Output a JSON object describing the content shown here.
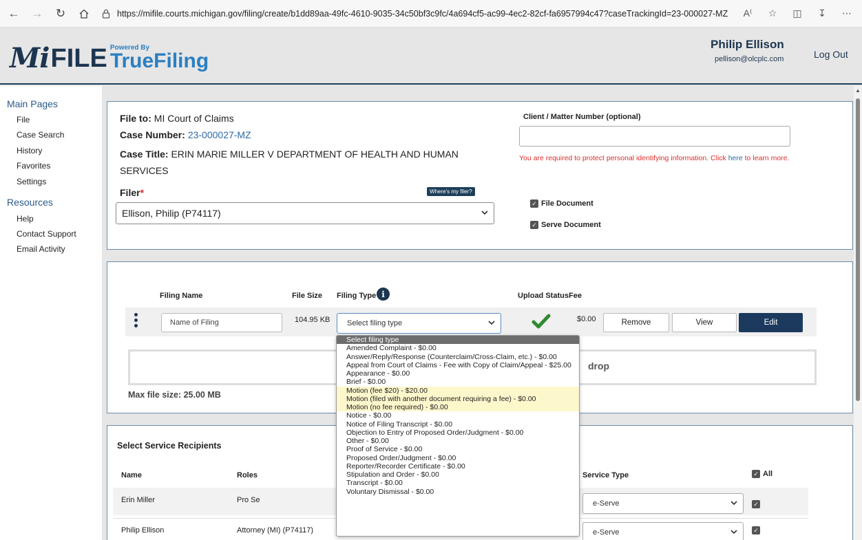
{
  "browser": {
    "url": "https://mifile.courts.michigan.gov/filing/create/b1dd89aa-49fc-4610-9035-34c50bf3c9fc/4a694cf5-ac99-4ec2-82cf-fa6957994c47?caseTrackingId=23-000027-MZ"
  },
  "header": {
    "logo_mi": "Mi",
    "logo_file": "FILE",
    "logo_powered": "Powered By",
    "logo_truefiling": "TrueFiling",
    "user_name": "Philip Ellison",
    "user_email": "pellison@olcplc.com",
    "logout": "Log Out"
  },
  "sidebar": {
    "main_heading": "Main Pages",
    "main_items": [
      "File",
      "Case Search",
      "History",
      "Favorites",
      "Settings"
    ],
    "resources_heading": "Resources",
    "resource_items": [
      "Help",
      "Contact Support",
      "Email Activity"
    ]
  },
  "case": {
    "file_to_label": "File to:",
    "file_to_value": "MI Court of Claims",
    "case_number_label": "Case Number:",
    "case_number_value": "23-000027-MZ",
    "case_title_label": "Case Title:",
    "case_title_value": "ERIN MARIE MILLER V DEPARTMENT OF HEALTH AND HUMAN SERVICES",
    "filer_label": "Filer",
    "filer_required": "*",
    "wheres_my_filer": "Where's my filer?",
    "filer_value": "Ellison, Philip (P74117)",
    "client_matter_label": "Client / Matter Number (optional)",
    "client_matter_value": "",
    "pii_text_before": "You are required to protect personal identifying information. Click ",
    "pii_link": "here",
    "pii_text_after": " to learn more.",
    "file_document_label": "File Document",
    "serve_document_label": "Serve Document"
  },
  "filing": {
    "col_filing_name": "Filing Name",
    "col_file_size": "File Size",
    "col_filing_type": "Filing Type",
    "col_upload_status": "Upload Status",
    "col_fee": "Fee",
    "name_placeholder": "Name of Filing",
    "file_size": "104.95 KB",
    "filing_type_selected": "Select filing type",
    "fee": "$0.00",
    "remove_label": "Remove",
    "view_label": "View",
    "edit_label": "Edit",
    "drop_text": "drop",
    "max_file_size": "Max file size: 25.00 MB"
  },
  "filing_type_options": [
    "Select filing type",
    "Amended Complaint - $0.00",
    "Answer/Reply/Response (Counterclaim/Cross-Claim, etc.) - $0.00",
    "Appeal from Court of Claims - Fee with Copy of Claim/Appeal - $25.00",
    "Appearance - $0.00",
    "Brief - $0.00",
    "Motion (fee $20) - $20.00",
    "Motion (filed with another document requiring a fee) - $0.00",
    "Motion (no fee required) - $0.00",
    "Notice - $0.00",
    "Notice of Filing Transcript - $0.00",
    "Objection to Entry of Proposed Order/Judgment - $0.00",
    "Other - $0.00",
    "Proof of Service - $0.00",
    "Proposed Order/Judgment - $0.00",
    "Reporter/Recorder Certificate - $0.00",
    "Stipulation and Order - $0.00",
    "Transcript - $0.00",
    "Voluntary Dismissal - $0.00"
  ],
  "service": {
    "title": "Select Service Recipients",
    "col_name": "Name",
    "col_roles": "Roles",
    "col_service_type": "Service Type",
    "col_all": "All",
    "recipients": [
      {
        "name": "Erin Miller",
        "role": "Pro Se",
        "service_type": "e-Serve"
      },
      {
        "name": "Philip Ellison",
        "role": "Attorney (MI) (P74117)",
        "service_type": "e-Serve"
      }
    ]
  }
}
